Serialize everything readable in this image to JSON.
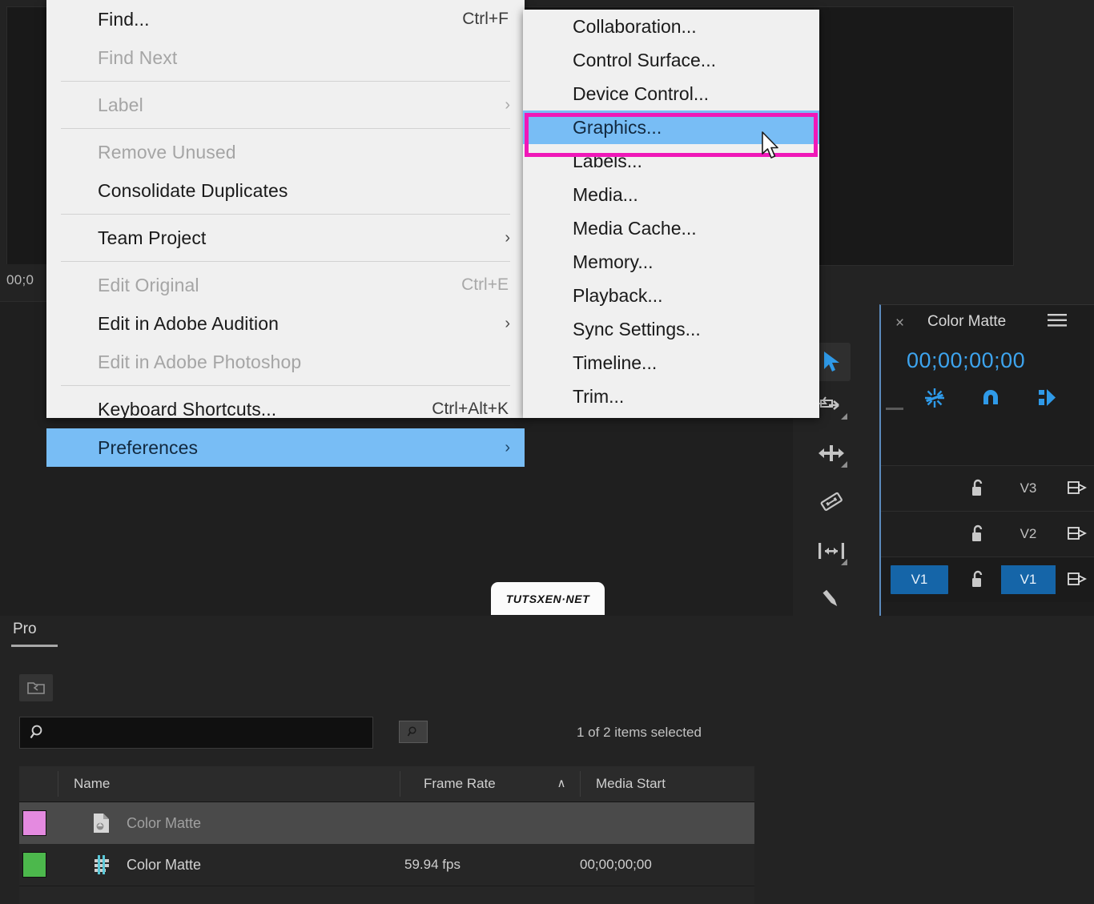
{
  "app": {
    "monitor_timecode": "00;0"
  },
  "project_panel": {
    "tab_label": "Pro",
    "bin_icon": "new-bin-icon",
    "search_placeholder": "",
    "search_value": "",
    "find_icon": "find-icon",
    "items_selected": "1 of 2 items selected",
    "columns": [
      "Name",
      "Frame Rate",
      "Media Start"
    ],
    "sort_arrow": "∧",
    "rows": [
      {
        "swatch_color": "#e48ae0",
        "icon": "color-matte-still-icon",
        "name": "Color Matte",
        "frame_rate": "",
        "media_start": "",
        "selected": true
      },
      {
        "swatch_color": "#4cb84c",
        "icon": "sequence-icon",
        "name": "Color Matte",
        "frame_rate": "59.94 fps",
        "media_start": "00;00;00;00",
        "selected": false
      }
    ]
  },
  "tools": [
    {
      "name": "selection-tool",
      "icon": "arrow-cursor-icon",
      "active": true
    },
    {
      "name": "track-select-forward-tool",
      "icon": "track-select-icon",
      "active": false
    },
    {
      "name": "ripple-edit-tool",
      "icon": "ripple-edit-icon",
      "active": false
    },
    {
      "name": "rate-stretch-tool",
      "icon": "rate-stretch-icon",
      "active": false
    },
    {
      "name": "slip-tool",
      "icon": "slip-icon",
      "active": false
    },
    {
      "name": "pen-tool",
      "icon": "pen-icon",
      "active": false
    }
  ],
  "timeline_panel": {
    "close_glyph": "×",
    "title": "Color Matte",
    "menu_icon": "hamburger-menu-icon",
    "timecode": "00;00;00;00",
    "icons": [
      {
        "name": "insert-overwrite-sequence-icon"
      },
      {
        "name": "snap-magnet-icon"
      },
      {
        "name": "linked-selection-icon"
      }
    ],
    "tracks": [
      {
        "badge": "",
        "label": "V3",
        "label_on": false,
        "lock_icon": "unlock-icon",
        "sync_icon": "sync-lock-icon"
      },
      {
        "badge": "",
        "label": "V2",
        "label_on": false,
        "lock_icon": "unlock-icon",
        "sync_icon": "sync-lock-icon"
      },
      {
        "badge": "V1",
        "label": "V1",
        "label_on": true,
        "lock_icon": "unlock-icon",
        "sync_icon": "sync-lock-icon"
      }
    ]
  },
  "menu_main": {
    "items": [
      {
        "label": "Find...",
        "accel": "Ctrl+F",
        "arrow": false,
        "dim": false,
        "selected": false,
        "sep_after": false
      },
      {
        "label": "Find Next",
        "accel": "",
        "arrow": false,
        "dim": true,
        "selected": false,
        "sep_after": true
      },
      {
        "label": "Label",
        "accel": "",
        "arrow": true,
        "dim": true,
        "selected": false,
        "sep_after": true
      },
      {
        "label": "Remove Unused",
        "accel": "",
        "arrow": false,
        "dim": true,
        "selected": false,
        "sep_after": false
      },
      {
        "label": "Consolidate Duplicates",
        "accel": "",
        "arrow": false,
        "dim": false,
        "selected": false,
        "sep_after": true
      },
      {
        "label": "Team Project",
        "accel": "",
        "arrow": true,
        "dim": false,
        "selected": false,
        "sep_after": true
      },
      {
        "label": "Edit Original",
        "accel": "Ctrl+E",
        "arrow": false,
        "dim": true,
        "selected": false,
        "sep_after": false
      },
      {
        "label": "Edit in Adobe Audition",
        "accel": "",
        "arrow": true,
        "dim": false,
        "selected": false,
        "sep_after": false
      },
      {
        "label": "Edit in Adobe Photoshop",
        "accel": "",
        "arrow": false,
        "dim": true,
        "selected": false,
        "sep_after": true
      },
      {
        "label": "Keyboard Shortcuts...",
        "accel": "Ctrl+Alt+K",
        "arrow": false,
        "dim": false,
        "selected": false,
        "sep_after": false
      },
      {
        "label": "Preferences",
        "accel": "",
        "arrow": true,
        "dim": false,
        "selected": true,
        "sep_after": false
      }
    ]
  },
  "menu_sub": {
    "items": [
      {
        "label": "Collaboration...",
        "selected": false
      },
      {
        "label": "Control Surface...",
        "selected": false
      },
      {
        "label": "Device Control...",
        "selected": false
      },
      {
        "label": "Graphics...",
        "selected": true
      },
      {
        "label": "Labels...",
        "selected": false
      },
      {
        "label": "Media...",
        "selected": false
      },
      {
        "label": "Media Cache...",
        "selected": false
      },
      {
        "label": "Memory...",
        "selected": false
      },
      {
        "label": "Playback...",
        "selected": false
      },
      {
        "label": "Sync Settings...",
        "selected": false
      },
      {
        "label": "Timeline...",
        "selected": false
      },
      {
        "label": "Trim...",
        "selected": false
      }
    ]
  },
  "highlight": {
    "color": "#f018b8",
    "target": "Graphics..."
  },
  "watermark": {
    "text": "TUTSXEN·NET"
  }
}
